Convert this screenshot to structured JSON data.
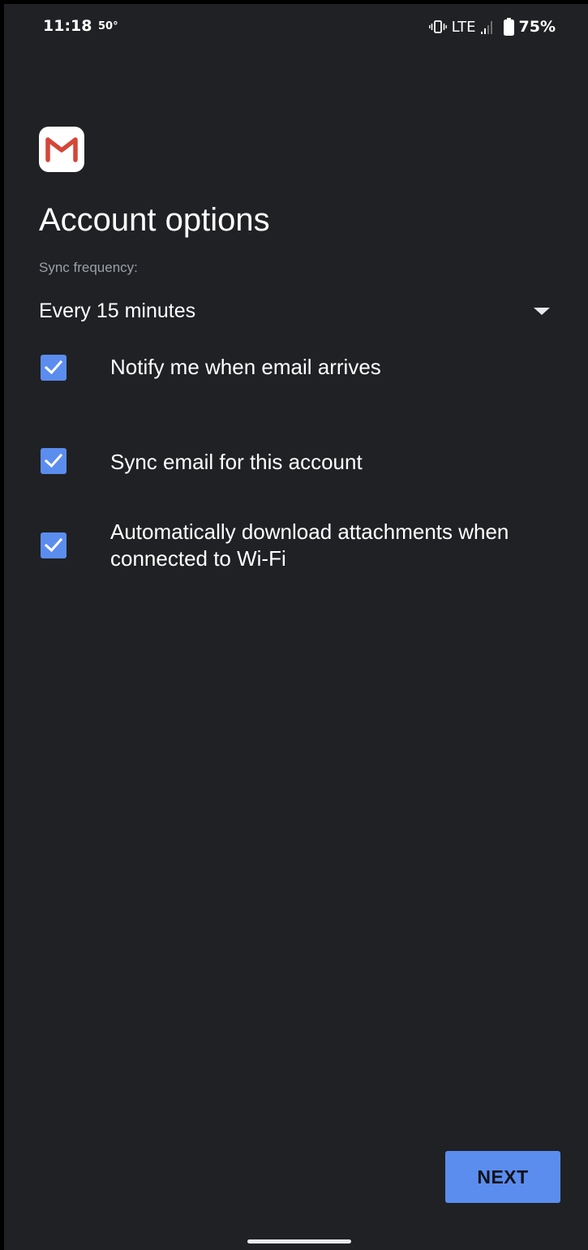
{
  "status_bar": {
    "time": "11:18",
    "temperature": "50°",
    "network": "LTE",
    "battery": "75%",
    "icons": [
      "vibrate-icon",
      "signal-icon",
      "battery-icon"
    ]
  },
  "app": {
    "logo": "gmail-logo",
    "title": "Account options"
  },
  "sync": {
    "label": "Sync frequency:",
    "selected": "Every 15 minutes"
  },
  "options": [
    {
      "label": "Notify me when email arrives",
      "checked": true
    },
    {
      "label": "Sync email for this account",
      "checked": true
    },
    {
      "label": "Automatically download attachments when connected to Wi-Fi",
      "checked": true
    }
  ],
  "actions": {
    "next_label": "NEXT"
  },
  "colors": {
    "background": "#202124",
    "accent": "#5b8def",
    "text_primary": "#ffffff",
    "text_secondary": "#9aa0a6",
    "gmail_red": "#d44638"
  }
}
